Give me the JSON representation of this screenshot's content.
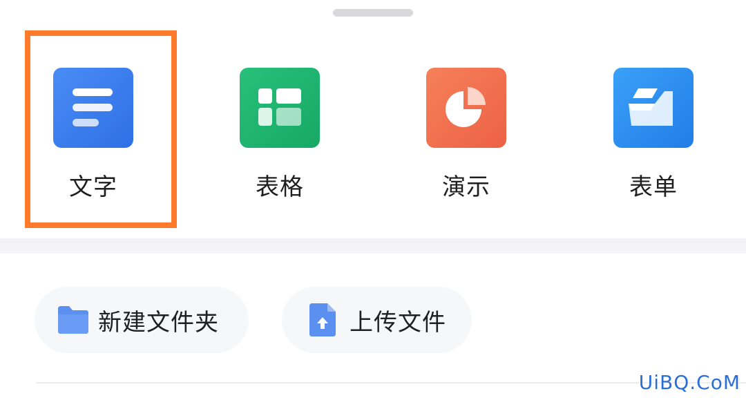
{
  "create_options": [
    {
      "label": "文字",
      "icon": "document-icon",
      "color": "#3d7ef0"
    },
    {
      "label": "表格",
      "icon": "spreadsheet-icon",
      "color": "#1fb370"
    },
    {
      "label": "演示",
      "icon": "presentation-pie-icon",
      "color": "#f07050"
    },
    {
      "label": "表单",
      "icon": "form-icon",
      "color": "#2f8df2"
    }
  ],
  "actions": [
    {
      "label": "新建文件夹",
      "icon": "folder-icon"
    },
    {
      "label": "上传文件",
      "icon": "upload-file-icon"
    }
  ],
  "highlight_color": "#ff7a2a",
  "watermark": "UiBQ.CoM"
}
